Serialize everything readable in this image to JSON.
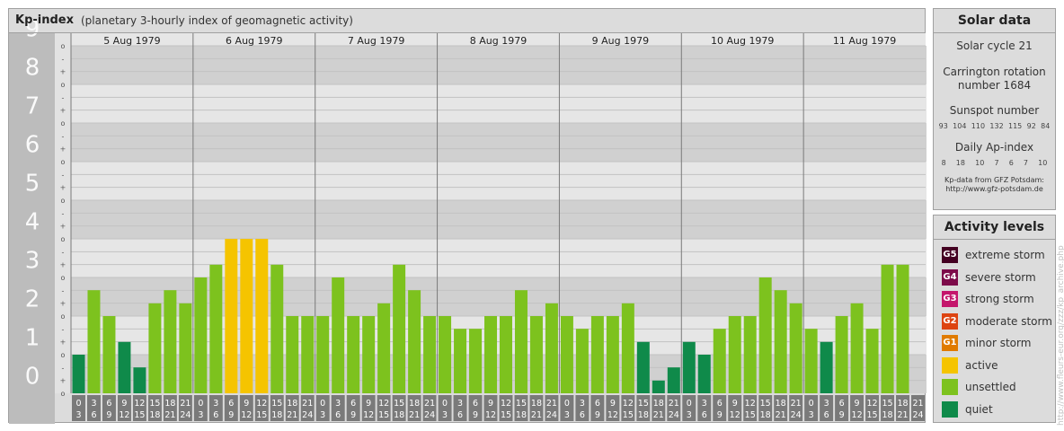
{
  "header": {
    "title": "Kp-index",
    "subtitle": "(planetary 3-hourly index of geomagnetic activity)"
  },
  "chart_data": {
    "type": "bar",
    "title": "Kp-index",
    "subtitle": "(planetary 3-hourly index of geomagnetic activity)",
    "ylim": [
      0,
      9
    ],
    "y_ticks": [
      "0",
      "1",
      "2",
      "3",
      "4",
      "5",
      "6",
      "7",
      "8",
      "9"
    ],
    "minor_marks": [
      "o",
      "+",
      "-"
    ],
    "days": [
      "5 Aug 1979",
      "6 Aug 1979",
      "7 Aug 1979",
      "8 Aug 1979",
      "9 Aug 1979",
      "10 Aug 1979",
      "11 Aug 1979"
    ],
    "hour_labels": [
      [
        "0",
        "3"
      ],
      [
        "3",
        "6"
      ],
      [
        "6",
        "9"
      ],
      [
        "9",
        "12"
      ],
      [
        "12",
        "15"
      ],
      [
        "15",
        "18"
      ],
      [
        "18",
        "21"
      ],
      [
        "21",
        "24"
      ]
    ],
    "values": [
      [
        1.0,
        2.67,
        2.0,
        1.33,
        0.67,
        2.33,
        2.67,
        2.33
      ],
      [
        3.0,
        3.33,
        4.0,
        4.0,
        4.0,
        3.33,
        2.0,
        2.0
      ],
      [
        2.0,
        3.0,
        2.0,
        2.0,
        2.33,
        3.33,
        2.67,
        2.0
      ],
      [
        2.0,
        1.67,
        1.67,
        2.0,
        2.0,
        2.67,
        2.0,
        2.33
      ],
      [
        2.0,
        1.67,
        2.0,
        2.0,
        2.33,
        1.33,
        0.33,
        0.67
      ],
      [
        1.33,
        1.0,
        1.67,
        2.0,
        2.0,
        3.0,
        2.67,
        2.33
      ],
      [
        1.67,
        1.33,
        2.0,
        2.33,
        1.67,
        3.33,
        3.33,
        null
      ]
    ],
    "colors": {
      "quiet": "#0f8a4a",
      "unsettled": "#7dc21e",
      "active": "#f5c400",
      "G1": "#e07b00",
      "G2": "#dd4411",
      "G3": "#c4166c",
      "G4": "#7d0b4a",
      "G5": "#440022"
    },
    "grid": true
  },
  "solar": {
    "title": "Solar data",
    "cycle": "Solar cycle 21",
    "carrington_l1": "Carrington rotation",
    "carrington_l2": "number 1684",
    "sunspot_title": "Sunspot number",
    "sunspot": [
      "93",
      "104",
      "110",
      "132",
      "115",
      "92",
      "84"
    ],
    "ap_title": "Daily Ap-index",
    "ap": [
      "8",
      "18",
      "10",
      "7",
      "6",
      "7",
      "10"
    ],
    "source_l1": "Kp-data from GFZ Potsdam:",
    "source_l2": "http://www.gfz-potsdam.de"
  },
  "activity": {
    "title": "Activity levels",
    "items": [
      {
        "code": "G5",
        "label": "extreme storm",
        "color": "#440022"
      },
      {
        "code": "G4",
        "label": "severe storm",
        "color": "#7d0b4a"
      },
      {
        "code": "G3",
        "label": "strong storm",
        "color": "#c4166c"
      },
      {
        "code": "G2",
        "label": "moderate storm",
        "color": "#dd4411"
      },
      {
        "code": "G1",
        "label": "minor storm",
        "color": "#e07b00"
      },
      {
        "code": "",
        "label": "active",
        "color": "#f5c400"
      },
      {
        "code": "",
        "label": "unsettled",
        "color": "#7dc21e"
      },
      {
        "code": "",
        "label": "quiet",
        "color": "#0f8a4a"
      }
    ]
  },
  "watermark": "http://www.fleurs-eur.org/zzz/kp_archive.php"
}
